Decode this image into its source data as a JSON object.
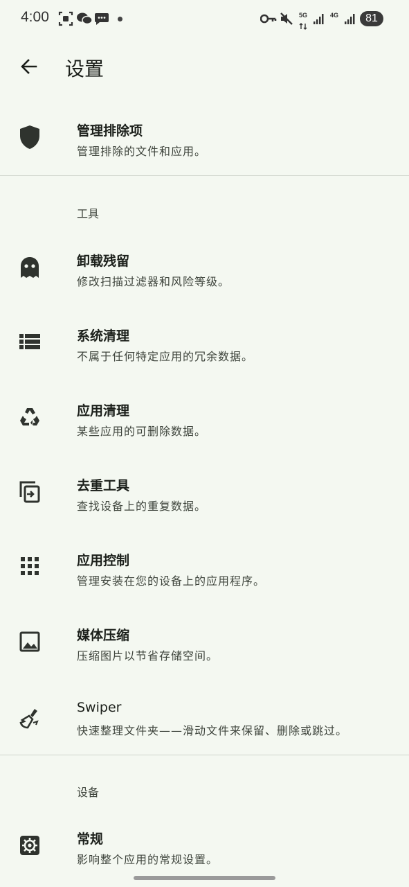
{
  "status_bar": {
    "time": "4:00",
    "network_5g": "5G",
    "network_4g": "4G",
    "battery": "81"
  },
  "app_bar": {
    "title": "设置"
  },
  "top_items": [
    {
      "icon": "shield-icon",
      "label": "管理排除项",
      "subtitle": "管理排除的文件和应用。"
    }
  ],
  "tools_section": {
    "header": "工具",
    "items": [
      {
        "icon": "ghost-icon",
        "label": "卸载残留",
        "subtitle": "修改扫描过滤器和风险等级。"
      },
      {
        "icon": "list-icon",
        "label": "系统清理",
        "subtitle": "不属于任何特定应用的冗余数据。"
      },
      {
        "icon": "recycle-icon",
        "label": "应用清理",
        "subtitle": "某些应用的可删除数据。"
      },
      {
        "icon": "duplicate-icon",
        "label": "去重工具",
        "subtitle": "查找设备上的重复数据。"
      },
      {
        "icon": "apps-grid-icon",
        "label": "应用控制",
        "subtitle": "管理安装在您的设备上的应用程序。"
      },
      {
        "icon": "image-icon",
        "label": "媒体压缩",
        "subtitle": "压缩图片以节省存储空间。"
      },
      {
        "icon": "broom-icon",
        "label": "Swiper",
        "subtitle": "快速整理文件夹——滑动文件来保留、删除或跳过。"
      }
    ]
  },
  "device_section": {
    "header": "设备",
    "items": [
      {
        "icon": "gear-icon",
        "label": "常规",
        "subtitle": "影响整个应用的常规设置。"
      }
    ]
  }
}
